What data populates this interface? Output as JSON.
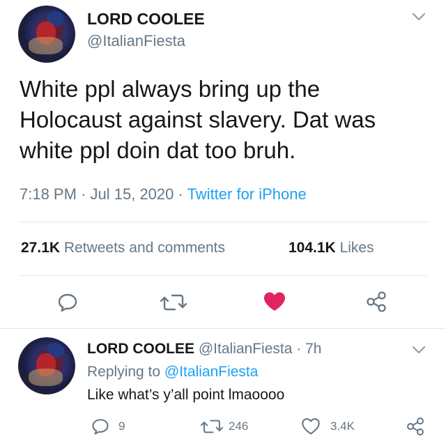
{
  "main_tweet": {
    "display_name": "LORD COOLEE",
    "handle": "@ItalianFiesta",
    "text_line1": "White ppl always bring up the",
    "text_line2": "Holocaust against slavery. Dat was",
    "text_line3": "white ppl doin dat too bruh.",
    "time": "7:18 PM",
    "sep1": "·",
    "date": "Jul 15, 2020",
    "sep2": "·",
    "source": "Twitter for iPhone",
    "retweets_count": "27.1K",
    "retweets_label": "Retweets and comments",
    "likes_count": "104.1K",
    "likes_label": "Likes"
  },
  "reply_tweet": {
    "display_name": "LORD COOLEE",
    "handle": "@ItalianFiesta",
    "sep": "·",
    "age": "7h",
    "replying_prefix": "Replying to",
    "replying_to": "@ItalianFiesta",
    "text": "Like what’s y’all point lmaoooo",
    "reply_count": "9",
    "retweet_count": "246",
    "like_count": "3.4K"
  },
  "colors": {
    "text": "#14171a",
    "secondary": "#657786",
    "link": "#1da1f2",
    "liked": "#e0245e",
    "divider": "#e1e8ed"
  },
  "icons": [
    "chevron-down-icon",
    "comment-icon",
    "retweet-icon",
    "heart-icon",
    "share-icon"
  ]
}
